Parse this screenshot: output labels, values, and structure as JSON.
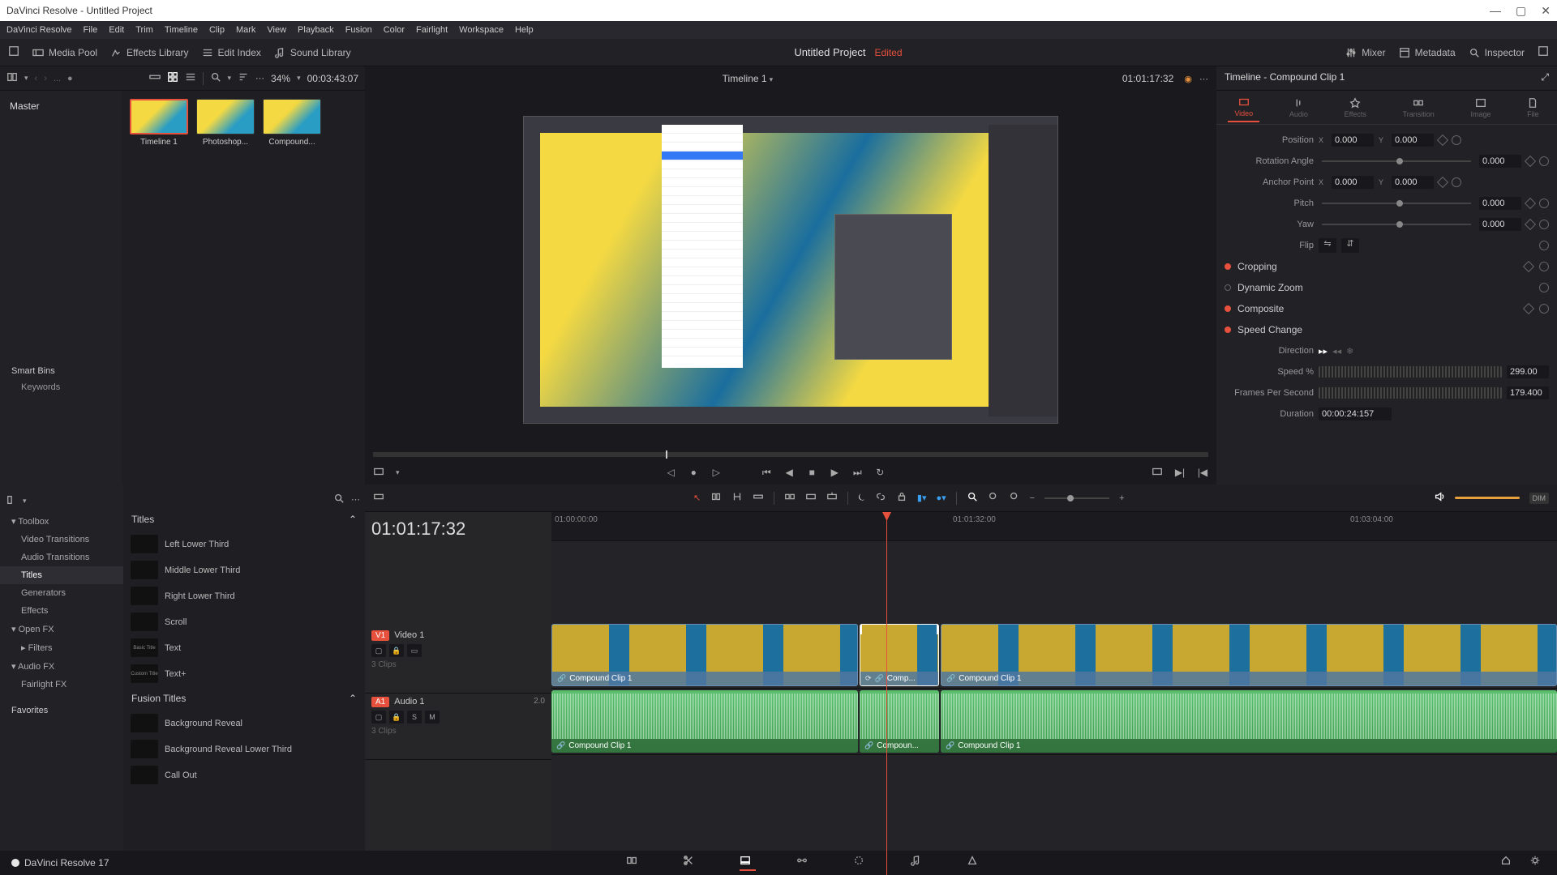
{
  "titlebar": "DaVinci Resolve - Untitled Project",
  "menubar": [
    "DaVinci Resolve",
    "File",
    "Edit",
    "Trim",
    "Timeline",
    "Clip",
    "Mark",
    "View",
    "Playback",
    "Fusion",
    "Color",
    "Fairlight",
    "Workspace",
    "Help"
  ],
  "toolbar": {
    "mediapool": "Media Pool",
    "effects": "Effects Library",
    "editindex": "Edit Index",
    "soundlib": "Sound Library",
    "title": "Untitled Project",
    "edited": "Edited",
    "mixer": "Mixer",
    "metadata": "Metadata",
    "inspector": "Inspector"
  },
  "mediapool": {
    "master": "Master",
    "zoom": "34%",
    "tc": "00:03:43:07",
    "thumbs": [
      {
        "name": "Timeline 1",
        "sel": true
      },
      {
        "name": "Photoshop..."
      },
      {
        "name": "Compound..."
      }
    ],
    "smartbins": "Smart Bins",
    "keywords": "Keywords"
  },
  "viewer": {
    "name": "Timeline 1",
    "tc": "01:01:17:32"
  },
  "inspector": {
    "title": "Timeline - Compound Clip 1",
    "tabs": [
      "Video",
      "Audio",
      "Effects",
      "Transition",
      "Image",
      "File"
    ],
    "position": {
      "label": "Position",
      "x": "0.000",
      "y": "0.000"
    },
    "rotation": {
      "label": "Rotation Angle",
      "val": "0.000"
    },
    "anchor": {
      "label": "Anchor Point",
      "x": "0.000",
      "y": "0.000"
    },
    "pitch": {
      "label": "Pitch",
      "val": "0.000"
    },
    "yaw": {
      "label": "Yaw",
      "val": "0.000"
    },
    "flip": {
      "label": "Flip"
    },
    "cropping": "Cropping",
    "dynzoom": "Dynamic Zoom",
    "composite": "Composite",
    "speed": "Speed Change",
    "direction": "Direction",
    "speedpct": {
      "label": "Speed %",
      "val": "299.00"
    },
    "fps": {
      "label": "Frames Per Second",
      "val": "179.400"
    },
    "duration": {
      "label": "Duration",
      "val": "00:00:24:157"
    }
  },
  "effects": {
    "tree": {
      "toolbox": "Toolbox",
      "vidtrans": "Video Transitions",
      "audtrans": "Audio Transitions",
      "titles": "Titles",
      "generators": "Generators",
      "fx": "Effects",
      "openfx": "Open FX",
      "filters": "Filters",
      "audiofx": "Audio FX",
      "fairlight": "Fairlight FX",
      "favorites": "Favorites"
    },
    "cat1": "Titles",
    "items1": [
      "Left Lower Third",
      "Middle Lower Third",
      "Right Lower Third",
      "Scroll",
      "Text",
      "Text+"
    ],
    "cat2": "Fusion Titles",
    "items2": [
      "Background Reveal",
      "Background Reveal Lower Third",
      "Call Out"
    ]
  },
  "timeline": {
    "tc": "01:01:17:32",
    "ruler": [
      "01:00:00:00",
      "01:01:32:00",
      "01:03:04:00"
    ],
    "v1": {
      "tag": "V1",
      "name": "Video 1",
      "clips": "3 Clips"
    },
    "a1": {
      "tag": "A1",
      "name": "Audio 1",
      "gain": "2.0",
      "clips": "3 Clips"
    },
    "clip1": "Compound Clip 1",
    "clip2": "Comp...",
    "clip2a": "Compoun...",
    "clip3": "Compound Clip 1"
  },
  "bottom": {
    "app": "DaVinci Resolve 17"
  }
}
